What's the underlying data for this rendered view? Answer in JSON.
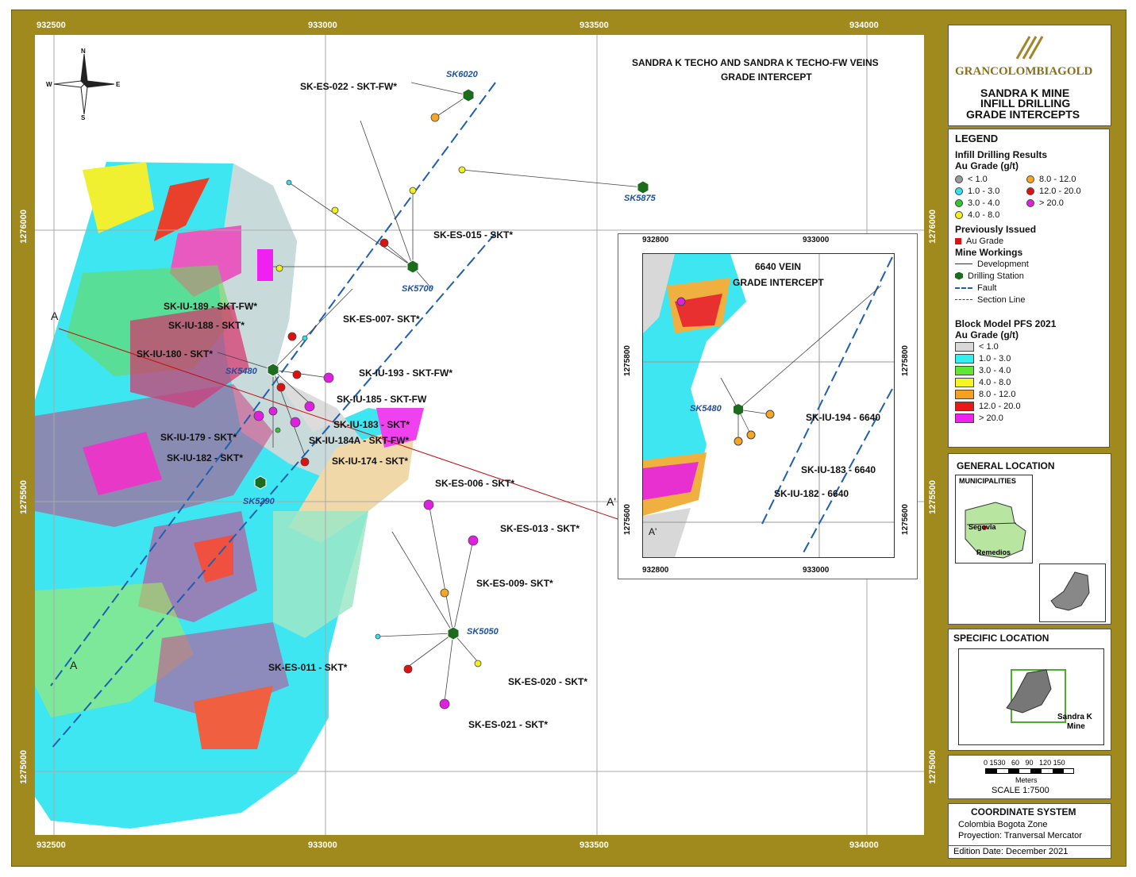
{
  "coords": {
    "x_top": [
      "932500",
      "933000",
      "933500",
      "934000"
    ],
    "x_bottom": [
      "932500",
      "933000",
      "933500",
      "934000"
    ],
    "y_left": [
      "1276000",
      "1275500",
      "1275000"
    ],
    "y_right": [
      "1276000",
      "1275500",
      "1275000"
    ]
  },
  "compass": {
    "n": "N",
    "s": "S",
    "e": "E",
    "w": "W"
  },
  "map_title": {
    "line1": "SANDRA K TECHO AND SANDRA K TECHO-FW VEINS",
    "line2": "GRADE INTERCEPT"
  },
  "stations": {
    "sk6020": "SK6020",
    "sk5875": "SK5875",
    "sk5700": "SK5700",
    "sk5480": "SK5480",
    "sk5290": "SK5290",
    "sk5050": "SK5050"
  },
  "intercepts": {
    "es022": "SK-ES-022 - SKT-FW*",
    "es015": "SK-ES-015 - SKT*",
    "iu189": "SK-IU-189 - SKT-FW*",
    "iu188": "SK-IU-188 - SKT*",
    "es007": "SK-ES-007- SKT*",
    "iu180": "SK-IU-180 - SKT*",
    "iu193": "SK-IU-193 - SKT-FW*",
    "iu185": "SK-IU-185 - SKT-FW",
    "iu183": "SK-IU-183 - SKT*",
    "iu179": "SK-IU-179 - SKT*",
    "iu184a": "SK-IU-184A - SKT-FW*",
    "iu182": "SK-IU-182 - SKT*",
    "iu174": "SK-IU-174 - SKT*",
    "es006": "SK-ES-006 - SKT*",
    "es013": "SK-ES-013 - SKT*",
    "es009": "SK-ES-009- SKT*",
    "es011": "SK-ES-011 - SKT*",
    "es020": "SK-ES-020 - SKT*",
    "es021": "SK-ES-021 - SKT*"
  },
  "section": {
    "a": "A",
    "a_prime": "A'"
  },
  "inset": {
    "title1": "6640 VEIN",
    "title2": "GRADE INTERCEPT",
    "x_top": [
      "932800",
      "933000"
    ],
    "x_bottom": [
      "932800",
      "933000"
    ],
    "y_left": [
      "1275800",
      "1275600"
    ],
    "y_right": [
      "1275800",
      "1275600"
    ],
    "station": "SK5480",
    "a_prime": "A'",
    "iu194": "SK-IU-194 - 6640",
    "iu183": "SK-IU-183 - 6640",
    "iu182": "SK-IU-182 - 6640"
  },
  "brand": {
    "logo": "GRANCOLOMBIAGOLD",
    "title1": "SANDRA K MINE",
    "title2": "INFILL DRILLING",
    "title3": "GRADE INTERCEPTS"
  },
  "legend": {
    "title": "LEGEND",
    "infill_title": "Infill Drilling Results",
    "infill_sub": "Au Grade (g/t)",
    "infill_items": [
      {
        "label": "< 1.0",
        "color": "#9a9a9a"
      },
      {
        "label": "1.0 - 3.0",
        "color": "#33e0f0"
      },
      {
        "label": "3.0 - 4.0",
        "color": "#2ec82e"
      },
      {
        "label": "4.0 - 8.0",
        "color": "#f0f020"
      },
      {
        "label": "8.0 - 12.0",
        "color": "#f5a623"
      },
      {
        "label": "12.0 - 20.0",
        "color": "#e01010"
      },
      {
        "label": "> 20.0",
        "color": "#e020e0"
      }
    ],
    "prev_title": "Previously Issued",
    "prev_item": "Au Grade",
    "mine_title": "Mine Workings",
    "mine_items": [
      "Development",
      "Drilling Station",
      "Fault",
      "Section Line"
    ],
    "block_title": "Block Model PFS 2021",
    "block_sub": "Au Grade (g/t)",
    "block_items": [
      {
        "label": "< 1.0",
        "color": "#d8d8d8"
      },
      {
        "label": "1.0 - 3.0",
        "color": "#33f0f0"
      },
      {
        "label": "3.0 - 4.0",
        "color": "#60e830"
      },
      {
        "label": "4.0 - 8.0",
        "color": "#f5f520"
      },
      {
        "label": "8.0 - 12.0",
        "color": "#f5a020"
      },
      {
        "label": "12.0 - 20.0",
        "color": "#e81818"
      },
      {
        "label": "> 20.0",
        "color": "#f020f0"
      }
    ]
  },
  "general": {
    "title": "GENERAL LOCATION",
    "municipalities": "MUNICIPALITIES",
    "segovia": "Segovia",
    "remedios": "Remedios"
  },
  "specific": {
    "title": "SPECIFIC LOCATION",
    "mine_line1": "Sandra K",
    "mine_line2": "Mine"
  },
  "scale": {
    "ticks": "0 1530   60   90   120 150",
    "units": "Meters",
    "scale": "SCALE  1:7500"
  },
  "coord_system": {
    "title": "COORDINATE SYSTEM",
    "line1": "Colombia Bogota Zone",
    "line2": "Proyection: Tranversal Mercator"
  },
  "edition": "Edition Date: December 2021"
}
